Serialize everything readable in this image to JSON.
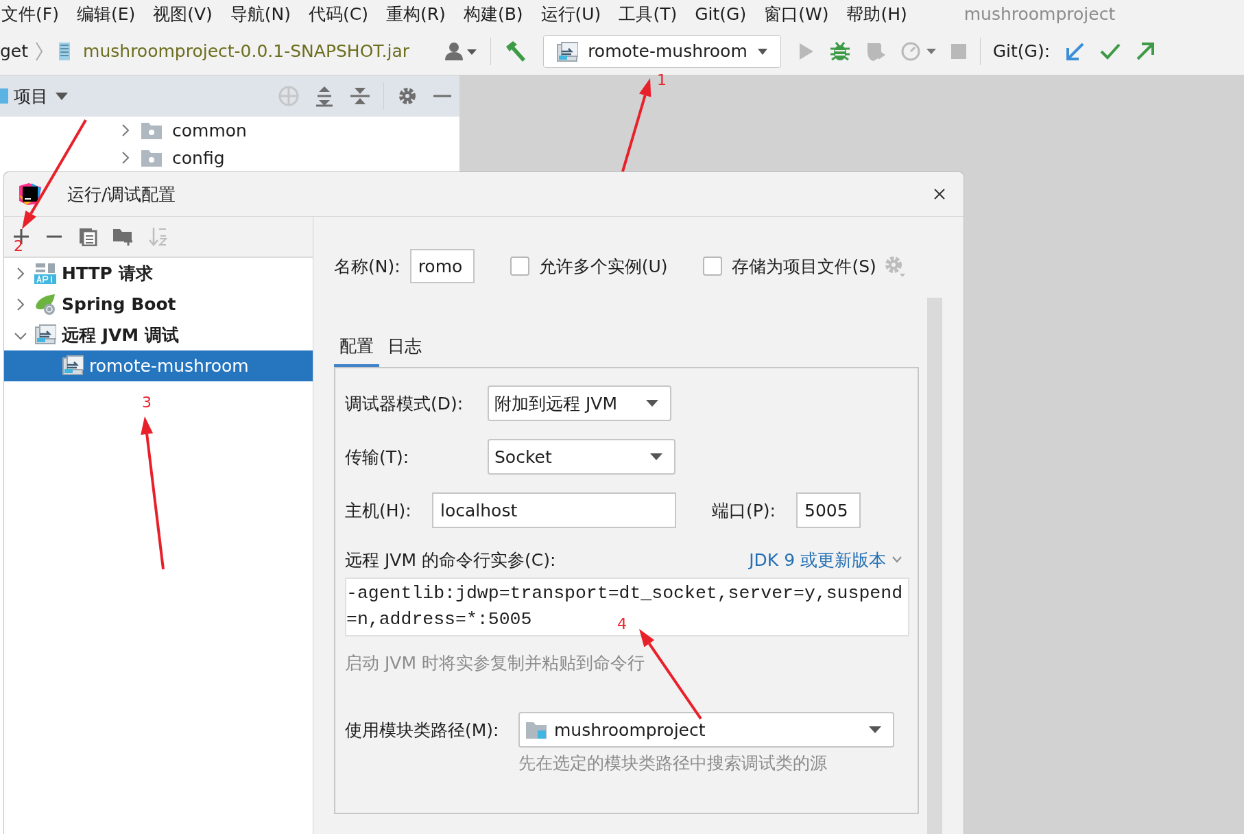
{
  "menu_bar": {
    "items": [
      "文件(F)",
      "编辑(E)",
      "视图(V)",
      "导航(N)",
      "代码(C)",
      "重构(R)",
      "构建(B)",
      "运行(U)",
      "工具(T)",
      "Git(G)",
      "窗口(W)",
      "帮助(H)"
    ],
    "project_title": "mushroomproject"
  },
  "nav_bar": {
    "breadcrumb": [
      "get",
      "mushroomproject-0.0.1-SNAPSHOT.jar"
    ],
    "run_config": "romote-mushroom",
    "git_label": "Git(G):"
  },
  "project_panel": {
    "title": "项目",
    "tree": [
      {
        "label": "common",
        "expanded": false
      },
      {
        "label": "config",
        "expanded": false
      }
    ]
  },
  "dialog": {
    "title": "运行/调试配置",
    "config_tree": [
      {
        "label": "HTTP 请求",
        "kind": "http",
        "expanded": false,
        "selected": false
      },
      {
        "label": "Spring Boot",
        "kind": "spring",
        "expanded": false,
        "selected": false
      },
      {
        "label": "远程 JVM 调试",
        "kind": "remote",
        "expanded": true,
        "selected": false,
        "children": [
          {
            "label": "romote-mushroom",
            "kind": "remote",
            "selected": true
          }
        ]
      }
    ],
    "name_label": "名称(N):",
    "name_value": "romo",
    "options": [
      {
        "label": "允许多个实例(U)",
        "checked": false
      },
      {
        "label": "存储为项目文件(S)",
        "checked": false
      }
    ],
    "tabs": [
      {
        "label": "配置",
        "selected": true
      },
      {
        "label": "日志",
        "selected": false
      }
    ],
    "form": {
      "debugger_mode": {
        "label": "调试器模式(D):",
        "value": "附加到远程 JVM"
      },
      "transport": {
        "label": "传输(T):",
        "value": "Socket"
      },
      "host": {
        "label": "主机(H):",
        "value": "localhost"
      },
      "port": {
        "label": "端口(P):",
        "value": "5005"
      },
      "command_line": {
        "label": "远程 JVM 的命令行实参(C):",
        "jdk_link": "JDK 9 或更新版本",
        "value": "-agentlib:jdwp=transport=dt_socket,server=y,suspend=n,address=*:5005",
        "hint": "启动 JVM 时将实参复制并粘贴到命令行"
      },
      "module_classpath": {
        "label": "使用模块类路径(M):",
        "value": "mushroomproject",
        "hint": "先在选定的模块类路径中搜索调试类的源"
      }
    }
  },
  "annotations": [
    {
      "label": "1"
    },
    {
      "label": "2"
    },
    {
      "label": "3"
    },
    {
      "label": "4"
    }
  ]
}
